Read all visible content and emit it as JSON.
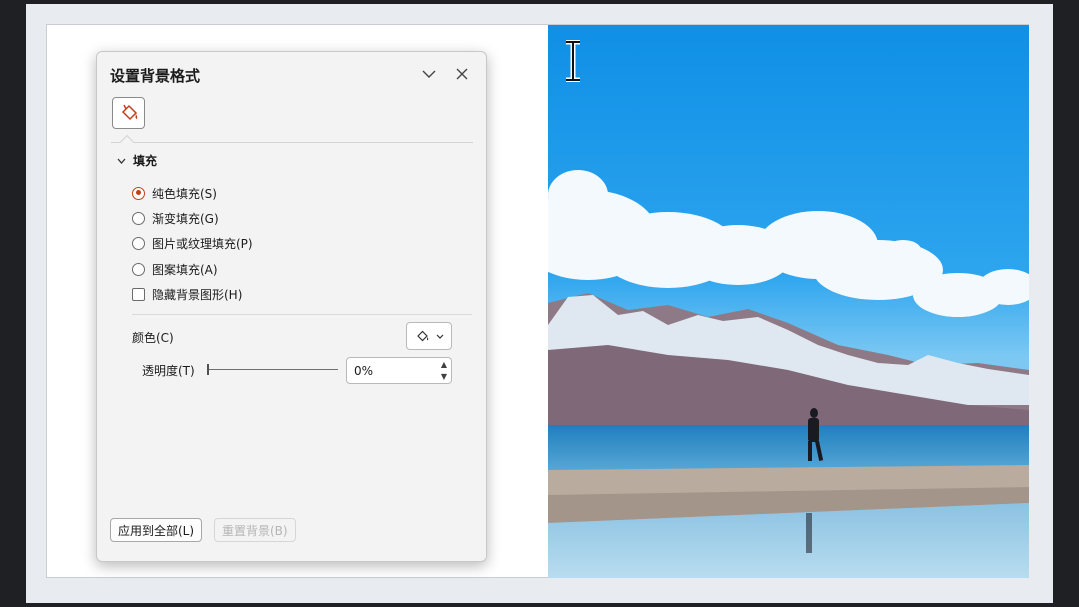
{
  "panel": {
    "title": "设置背景格式",
    "header_icons": [
      "chevron-down-icon",
      "close-icon"
    ],
    "tab_icon": "fill-bucket-icon",
    "section": "填充",
    "fill_options": [
      {
        "label": "纯色填充(S)",
        "selected": true
      },
      {
        "label": "渐变填充(G)",
        "selected": false
      },
      {
        "label": "图片或纹理填充(P)",
        "selected": false
      },
      {
        "label": "图案填充(A)",
        "selected": false
      }
    ],
    "hide_bg_graphics": {
      "label": "隐藏背景图形(H)",
      "checked": false
    },
    "color_label": "颜色(C)",
    "transparency_label": "透明度(T)",
    "transparency_value": "0%",
    "apply_all_button": "应用到全部(L)",
    "reset_button": "重置背景(B)"
  },
  "colors": {
    "accent": "#c43e1c",
    "panel_bg": "#f3f3f3"
  }
}
